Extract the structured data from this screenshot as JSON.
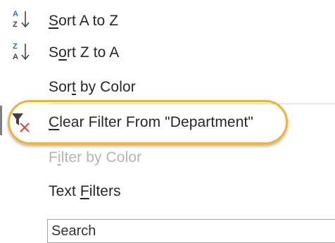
{
  "menu": {
    "sort_az": {
      "prefix": "",
      "accel": "S",
      "rest": "ort A to Z",
      "icon": "sort-ascending-icon"
    },
    "sort_za": {
      "prefix": "S",
      "accel": "o",
      "rest": "rt Z to A",
      "icon": "sort-descending-icon"
    },
    "sort_color": {
      "prefix": "Sor",
      "accel": "t",
      "rest": " by Color"
    },
    "clear_filter": {
      "prefix": "",
      "accel": "C",
      "rest": "lear Filter From \"Department\"",
      "icon": "clear-filter-icon"
    },
    "filter_color": {
      "prefix": "F",
      "accel": "i",
      "rest": "lter by Color",
      "disabled": true
    },
    "text_filters": {
      "prefix": "Text ",
      "accel": "F",
      "rest": "ilters"
    }
  },
  "search": {
    "placeholder": "Search"
  },
  "colors": {
    "highlight": "#f0b232",
    "sort_icon_blue": "#2f6fb6",
    "clear_x_red": "#e04848",
    "disabled_text": "#b4b4b4"
  }
}
